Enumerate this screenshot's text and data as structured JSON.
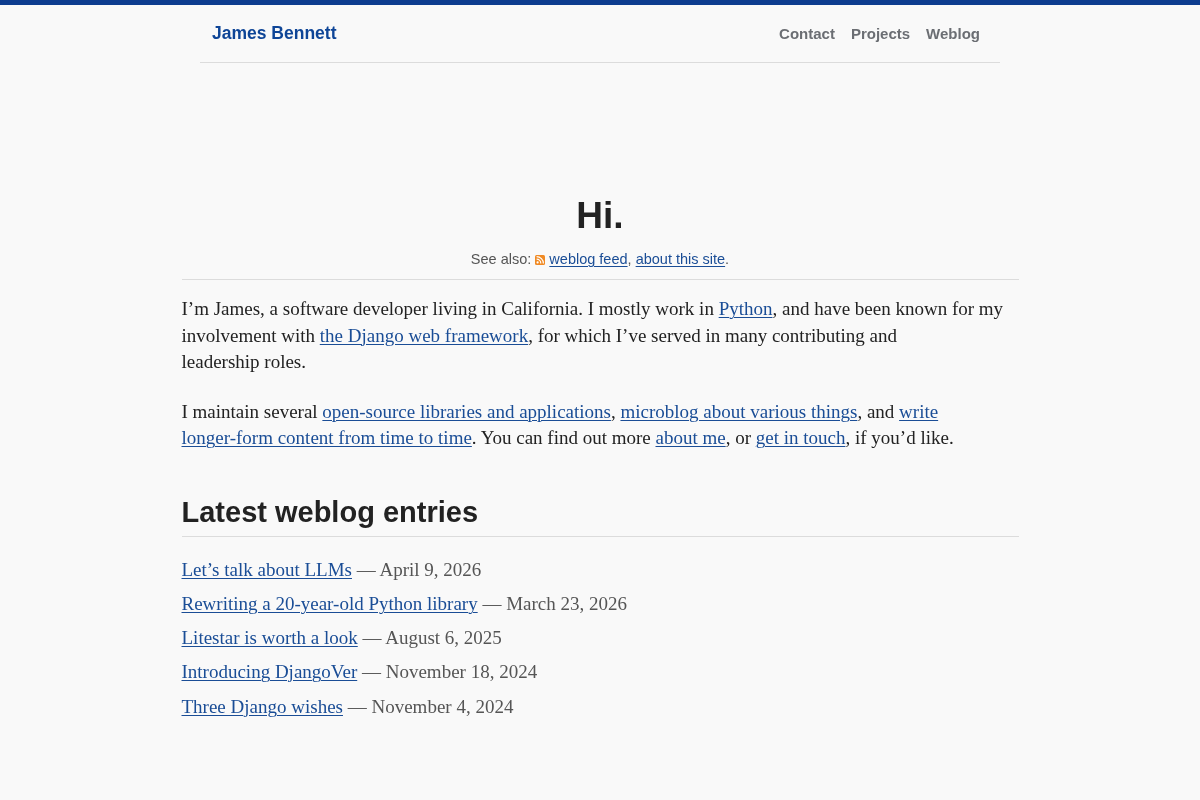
{
  "header": {
    "site_title": "James Bennett",
    "nav": [
      {
        "label": "Contact"
      },
      {
        "label": "Projects"
      },
      {
        "label": "Weblog"
      }
    ]
  },
  "hero": {
    "heading": "Hi.",
    "see_also": [
      {
        "kind": "text",
        "text": "See also: "
      },
      {
        "kind": "feed_link",
        "text": "weblog feed"
      },
      {
        "kind": "text",
        "text": ", "
      },
      {
        "kind": "link",
        "text": "about this site"
      },
      {
        "kind": "text",
        "text": "."
      }
    ]
  },
  "intro": [
    [
      {
        "kind": "text",
        "text": "I’m James, a software developer living in California. I mostly work in "
      },
      {
        "kind": "link",
        "text": "Python"
      },
      {
        "kind": "text",
        "text": ", and have been known for my involvement with "
      },
      {
        "kind": "link",
        "text": "the Django web framework"
      },
      {
        "kind": "text",
        "text": ", for which I’ve served in many contributing and leadership roles."
      }
    ],
    [
      {
        "kind": "text",
        "text": "I maintain several "
      },
      {
        "kind": "link",
        "text": "open-source libraries and applications"
      },
      {
        "kind": "text",
        "text": ", "
      },
      {
        "kind": "link",
        "text": "microblog about various things"
      },
      {
        "kind": "text",
        "text": ", and "
      },
      {
        "kind": "link",
        "text": "write "
      },
      {
        "kind": "link",
        "text": "longer-form content from time to time"
      },
      {
        "kind": "text",
        "text": ". You can find out more "
      },
      {
        "kind": "link",
        "text": "about me"
      },
      {
        "kind": "text",
        "text": ", or "
      },
      {
        "kind": "link",
        "text": "get in touch"
      },
      {
        "kind": "text",
        "text": ", if you’d like."
      }
    ]
  ],
  "latest_entries": {
    "heading": "Latest weblog entries",
    "entries": [
      {
        "title": "Let’s talk about LLMs",
        "date": "— April 9, 2026"
      },
      {
        "title": "Rewriting a 20-year-old Python library",
        "date": "— March 23, 2026"
      },
      {
        "title": "Litestar is worth a look",
        "date": "— August 6, 2025"
      },
      {
        "title": "Introducing DjangoVer",
        "date": "— November 18, 2024"
      },
      {
        "title": "Three Django wishes",
        "date": "— November 4, 2024"
      }
    ]
  }
}
